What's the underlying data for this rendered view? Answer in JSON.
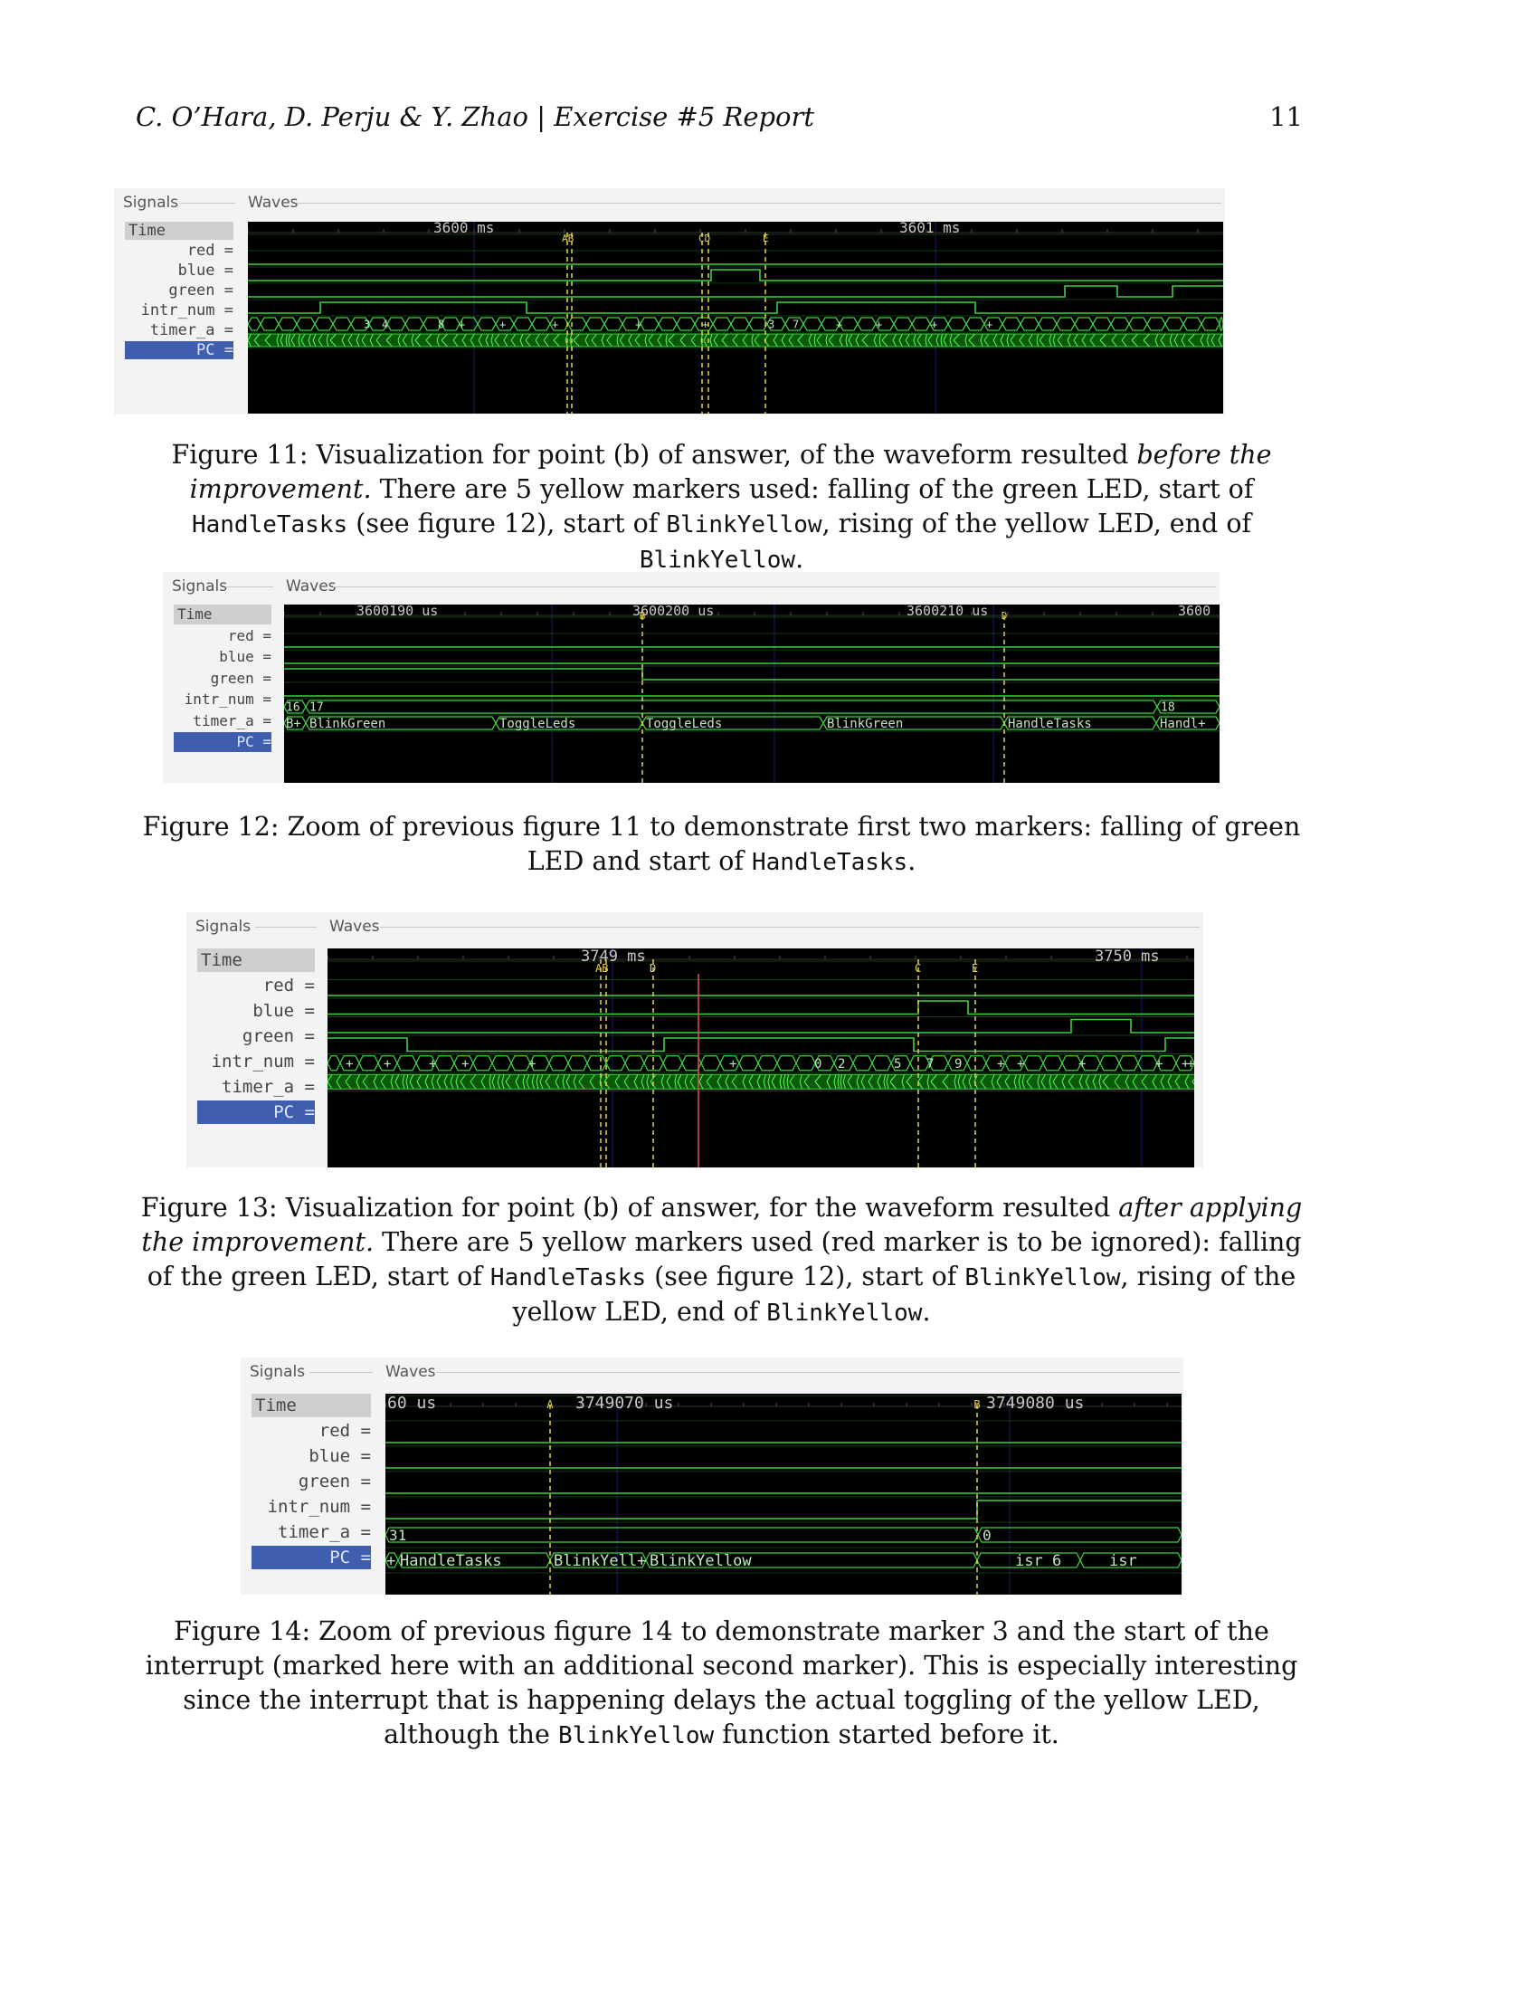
{
  "header": {
    "running_title": "C. O’Hara, D. Perju & Y. Zhao | Exercise #5 Report",
    "page_number": "11"
  },
  "signals_label": "Signals",
  "waves_label": "Waves",
  "signal_names": [
    "Time",
    "red",
    "blue",
    "green",
    "intr_num",
    "timer_a",
    "PC"
  ],
  "figures": [
    {
      "time_labels": [
        "3600 ms",
        "3601 ms"
      ],
      "marker_labels": [
        "AB",
        "CD",
        "E"
      ],
      "bus_values": [
        "3",
        "4",
        "8",
        "+",
        "+",
        "+",
        "+",
        "+",
        "3",
        "7",
        "+",
        "+",
        "+",
        "+"
      ]
    },
    {
      "time_labels": [
        "3600190 us",
        "3600200 us",
        "3600210 us",
        "3600"
      ],
      "marker_labels": [
        "B",
        "D"
      ],
      "timer_values": [
        "16",
        "17",
        "18"
      ],
      "pc_values": [
        "B+",
        "BlinkGreen",
        "ToggleLeds",
        "ToggleLeds",
        "BlinkGreen",
        "HandleTasks",
        "Handl+"
      ]
    },
    {
      "time_labels": [
        "3749 ms",
        "3750 ms"
      ],
      "marker_labels": [
        "AB",
        "D",
        "C",
        "E"
      ],
      "bus_values": [
        "+",
        "+",
        "+",
        "+",
        "+",
        "+",
        "0",
        "2",
        "5",
        "7",
        "9",
        "+",
        "+",
        "+",
        "+",
        "+",
        "+"
      ]
    },
    {
      "time_labels": [
        "60 us",
        "3749070 us",
        "3749080 us"
      ],
      "marker_labels": [
        "A",
        "B"
      ],
      "timer_values": [
        "31",
        "0"
      ],
      "pc_values": [
        "+",
        "HandleTasks",
        "BlinkYell+",
        "BlinkYellow",
        "isr 6",
        "isr"
      ]
    }
  ],
  "captions": {
    "fig11": {
      "p1": "Figure 11: Visualization for point (b) of answer, of the waveform resulted ",
      "i1": "before the improvement.",
      "p2": " There are 5 yellow markers used: falling of the green LED, start of ",
      "c1": "HandleTasks",
      "p3": " (see figure 12), start of ",
      "c2": "BlinkYellow",
      "p4": ", rising of the yellow LED, end of ",
      "c3": "BlinkYellow",
      "p5": "."
    },
    "fig12": {
      "p1": "Figure 12: Zoom of previous figure 11 to demonstrate first two markers: falling of green LED and start of ",
      "c1": "HandleTasks",
      "p2": "."
    },
    "fig13": {
      "p1": "Figure 13: Visualization for point (b) of answer, for the waveform resulted ",
      "i1": "after applying the improvement.",
      "p2": " There are 5 yellow markers used (red marker is to be ignored): falling of the green LED, start of ",
      "c1": "HandleTasks",
      "p3": " (see figure 12), start of ",
      "c2": "BlinkYellow",
      "p4": ", rising of the yellow LED, end of ",
      "c3": "BlinkYellow",
      "p5": "."
    },
    "fig14": {
      "p1": "Figure 14: Zoom of previous figure 14 to demonstrate marker 3 and the start of the interrupt (marked here with an additional second marker). This is especially interesting since the interrupt that is happening delays the actual toggling of the yellow LED, although the ",
      "c1": "BlinkYellow",
      "p2": " function started before it."
    }
  },
  "colors": {
    "wave_bg": "#000000",
    "trace": "#3fcf3f",
    "grid": "#123c12",
    "bus_fill": "#0a5a0a",
    "marker": "#e6d24a",
    "red_marker": "#e05050",
    "selection": "#3f5fae"
  }
}
